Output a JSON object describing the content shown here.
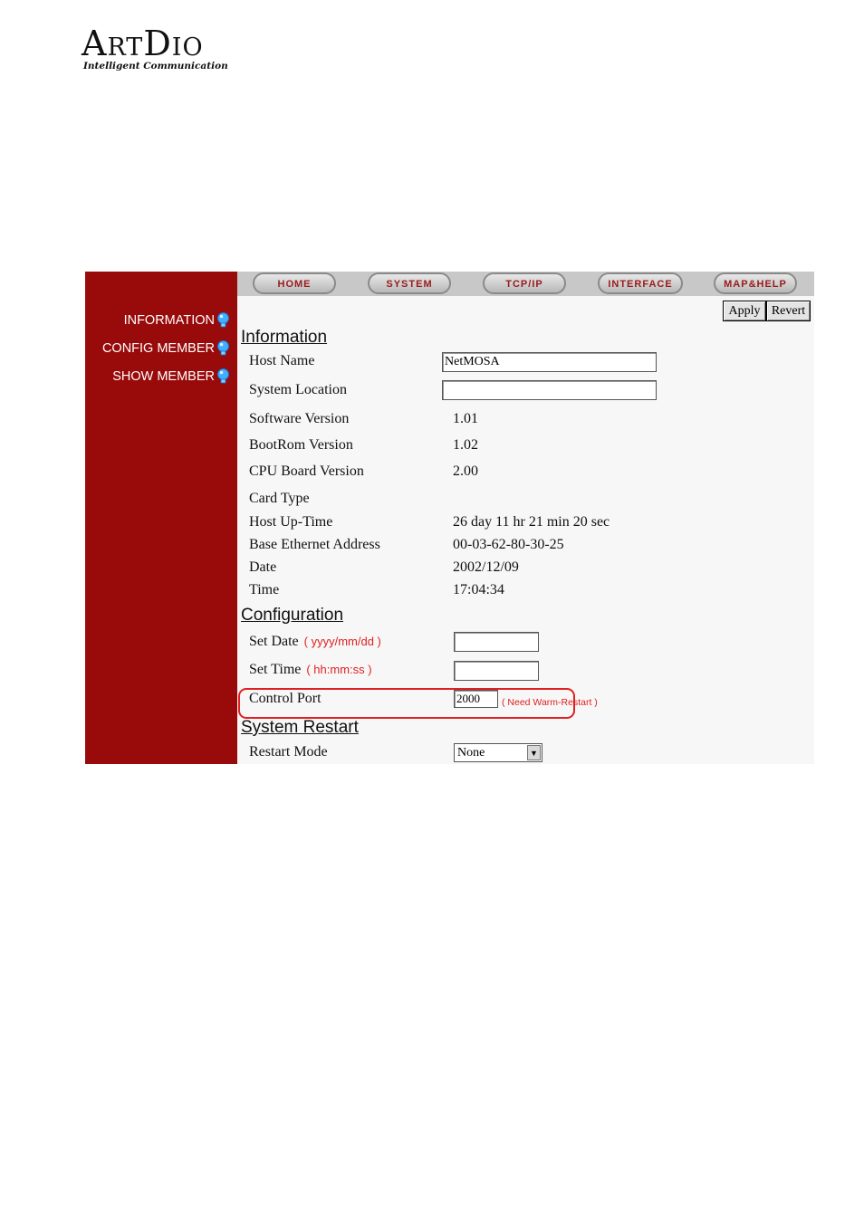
{
  "logo": {
    "brand": "ArtDio",
    "tagline": "Intelligent Communication"
  },
  "sidebar": {
    "items": [
      {
        "label": "INFORMATION",
        "icon": "lightbulb-icon"
      },
      {
        "label": "CONFIG MEMBER",
        "icon": "lightbulb-icon"
      },
      {
        "label": "SHOW MEMBER",
        "icon": "lightbulb-icon"
      }
    ]
  },
  "tabs": [
    "HOME",
    "SYSTEM",
    "TCP/IP",
    "INTERFACE",
    "MAP&HELP"
  ],
  "buttons": {
    "apply": "Apply",
    "revert": "Revert"
  },
  "information": {
    "title": "Information",
    "host_name": {
      "label": "Host Name",
      "value": "NetMOSA"
    },
    "system_location": {
      "label": "System Location",
      "value": ""
    },
    "rows": [
      {
        "label": "Software Version",
        "value": "1.01"
      },
      {
        "label": "BootRom Version",
        "value": "1.02"
      },
      {
        "label": "CPU Board Version",
        "value": "2.00"
      },
      {
        "label": "Card Type",
        "value": ""
      },
      {
        "label": "Host Up-Time",
        "value": "26 day 11 hr 21 min 20 sec"
      },
      {
        "label": "Base Ethernet Address",
        "value": "00-03-62-80-30-25"
      },
      {
        "label": "Date",
        "value": "2002/12/09"
      },
      {
        "label": "Time",
        "value": "17:04:34"
      }
    ]
  },
  "configuration": {
    "title": "Configuration",
    "set_date": {
      "label": "Set Date",
      "hint": "( yyyy/mm/dd )",
      "value": ""
    },
    "set_time": {
      "label": "Set Time",
      "hint": "( hh:mm:ss )",
      "value": ""
    },
    "control_port": {
      "label": "Control Port",
      "value": "2000",
      "hint": "( Need Warm-Restart )"
    }
  },
  "system_restart": {
    "title": "System Restart",
    "restart_mode": {
      "label": "Restart Mode",
      "value": "None"
    }
  },
  "colors": {
    "sidebar": "#990a0a",
    "hint": "#e02020",
    "tab_text": "#9a1a1a"
  }
}
